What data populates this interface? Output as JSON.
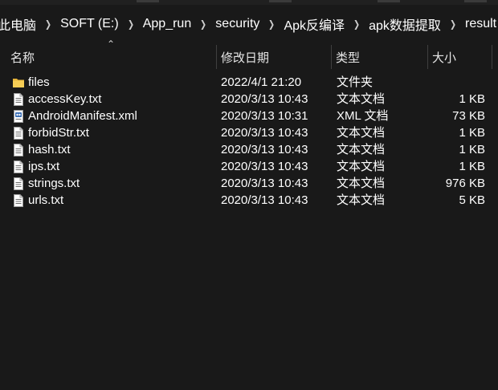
{
  "breadcrumb": {
    "items": [
      "此电脑",
      "SOFT (E:)",
      "App_run",
      "security",
      "Apk反编译",
      "apk数据提取",
      "result"
    ]
  },
  "columns": {
    "name": "名称",
    "date": "修改日期",
    "type": "类型",
    "size": "大小"
  },
  "files": [
    {
      "name": "files",
      "date": "2022/4/1 21:20",
      "type": "文件夹",
      "size": "",
      "icon": "folder-icon"
    },
    {
      "name": "accessKey.txt",
      "date": "2020/3/13 10:43",
      "type": "文本文档",
      "size": "1 KB",
      "icon": "text-file-icon"
    },
    {
      "name": "AndroidManifest.xml",
      "date": "2020/3/13 10:31",
      "type": "XML 文档",
      "size": "73 KB",
      "icon": "xml-file-icon"
    },
    {
      "name": "forbidStr.txt",
      "date": "2020/3/13 10:43",
      "type": "文本文档",
      "size": "1 KB",
      "icon": "text-file-icon"
    },
    {
      "name": "hash.txt",
      "date": "2020/3/13 10:43",
      "type": "文本文档",
      "size": "1 KB",
      "icon": "text-file-icon"
    },
    {
      "name": "ips.txt",
      "date": "2020/3/13 10:43",
      "type": "文本文档",
      "size": "1 KB",
      "icon": "text-file-icon"
    },
    {
      "name": "strings.txt",
      "date": "2020/3/13 10:43",
      "type": "文本文档",
      "size": "976 KB",
      "icon": "text-file-icon"
    },
    {
      "name": "urls.txt",
      "date": "2020/3/13 10:43",
      "type": "文本文档",
      "size": "5 KB",
      "icon": "text-file-icon"
    }
  ],
  "colors": {
    "background": "#191919",
    "text": "#ffffff",
    "folder": "#f4c542",
    "divider": "#3f3f3f"
  }
}
